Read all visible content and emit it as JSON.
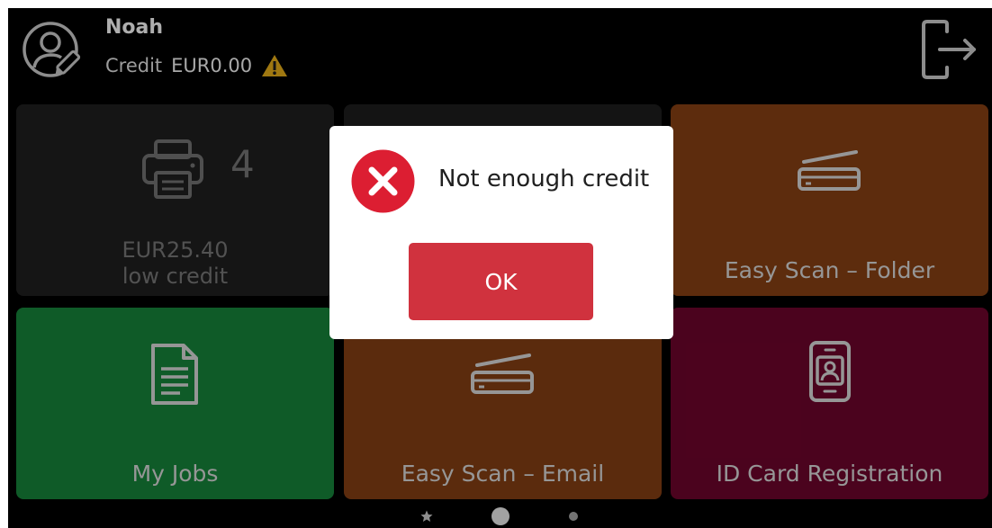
{
  "user": {
    "name": "Noah",
    "credit_label": "Credit",
    "credit_amount": "EUR0.00"
  },
  "tiles": {
    "print": {
      "job_count": "4",
      "credit_amount": "EUR25.40",
      "credit_status": "low credit"
    },
    "scan_folder": {
      "label": "Easy Scan – Folder"
    },
    "my_jobs": {
      "label": "My Jobs"
    },
    "scan_email": {
      "label": "Easy Scan – Email"
    },
    "id_card": {
      "label": "ID Card Registration"
    }
  },
  "dialog": {
    "message": "Not enough credit",
    "ok_label": "OK"
  },
  "pager": {
    "pages": 3,
    "active_page": 1
  },
  "colors": {
    "tile_folder": "#7c3b12",
    "tile_jobs": "#157a36",
    "tile_email": "#7a3a12",
    "tile_id": "#650428",
    "error": "#dc1e32",
    "ok_button": "#d0323e",
    "warning": "#d4a017"
  },
  "icons": [
    "user-avatar-icon",
    "warning-icon",
    "logout-icon",
    "printer-icon",
    "scanner-icon",
    "document-icon",
    "id-card-icon",
    "error-icon",
    "star-icon"
  ]
}
